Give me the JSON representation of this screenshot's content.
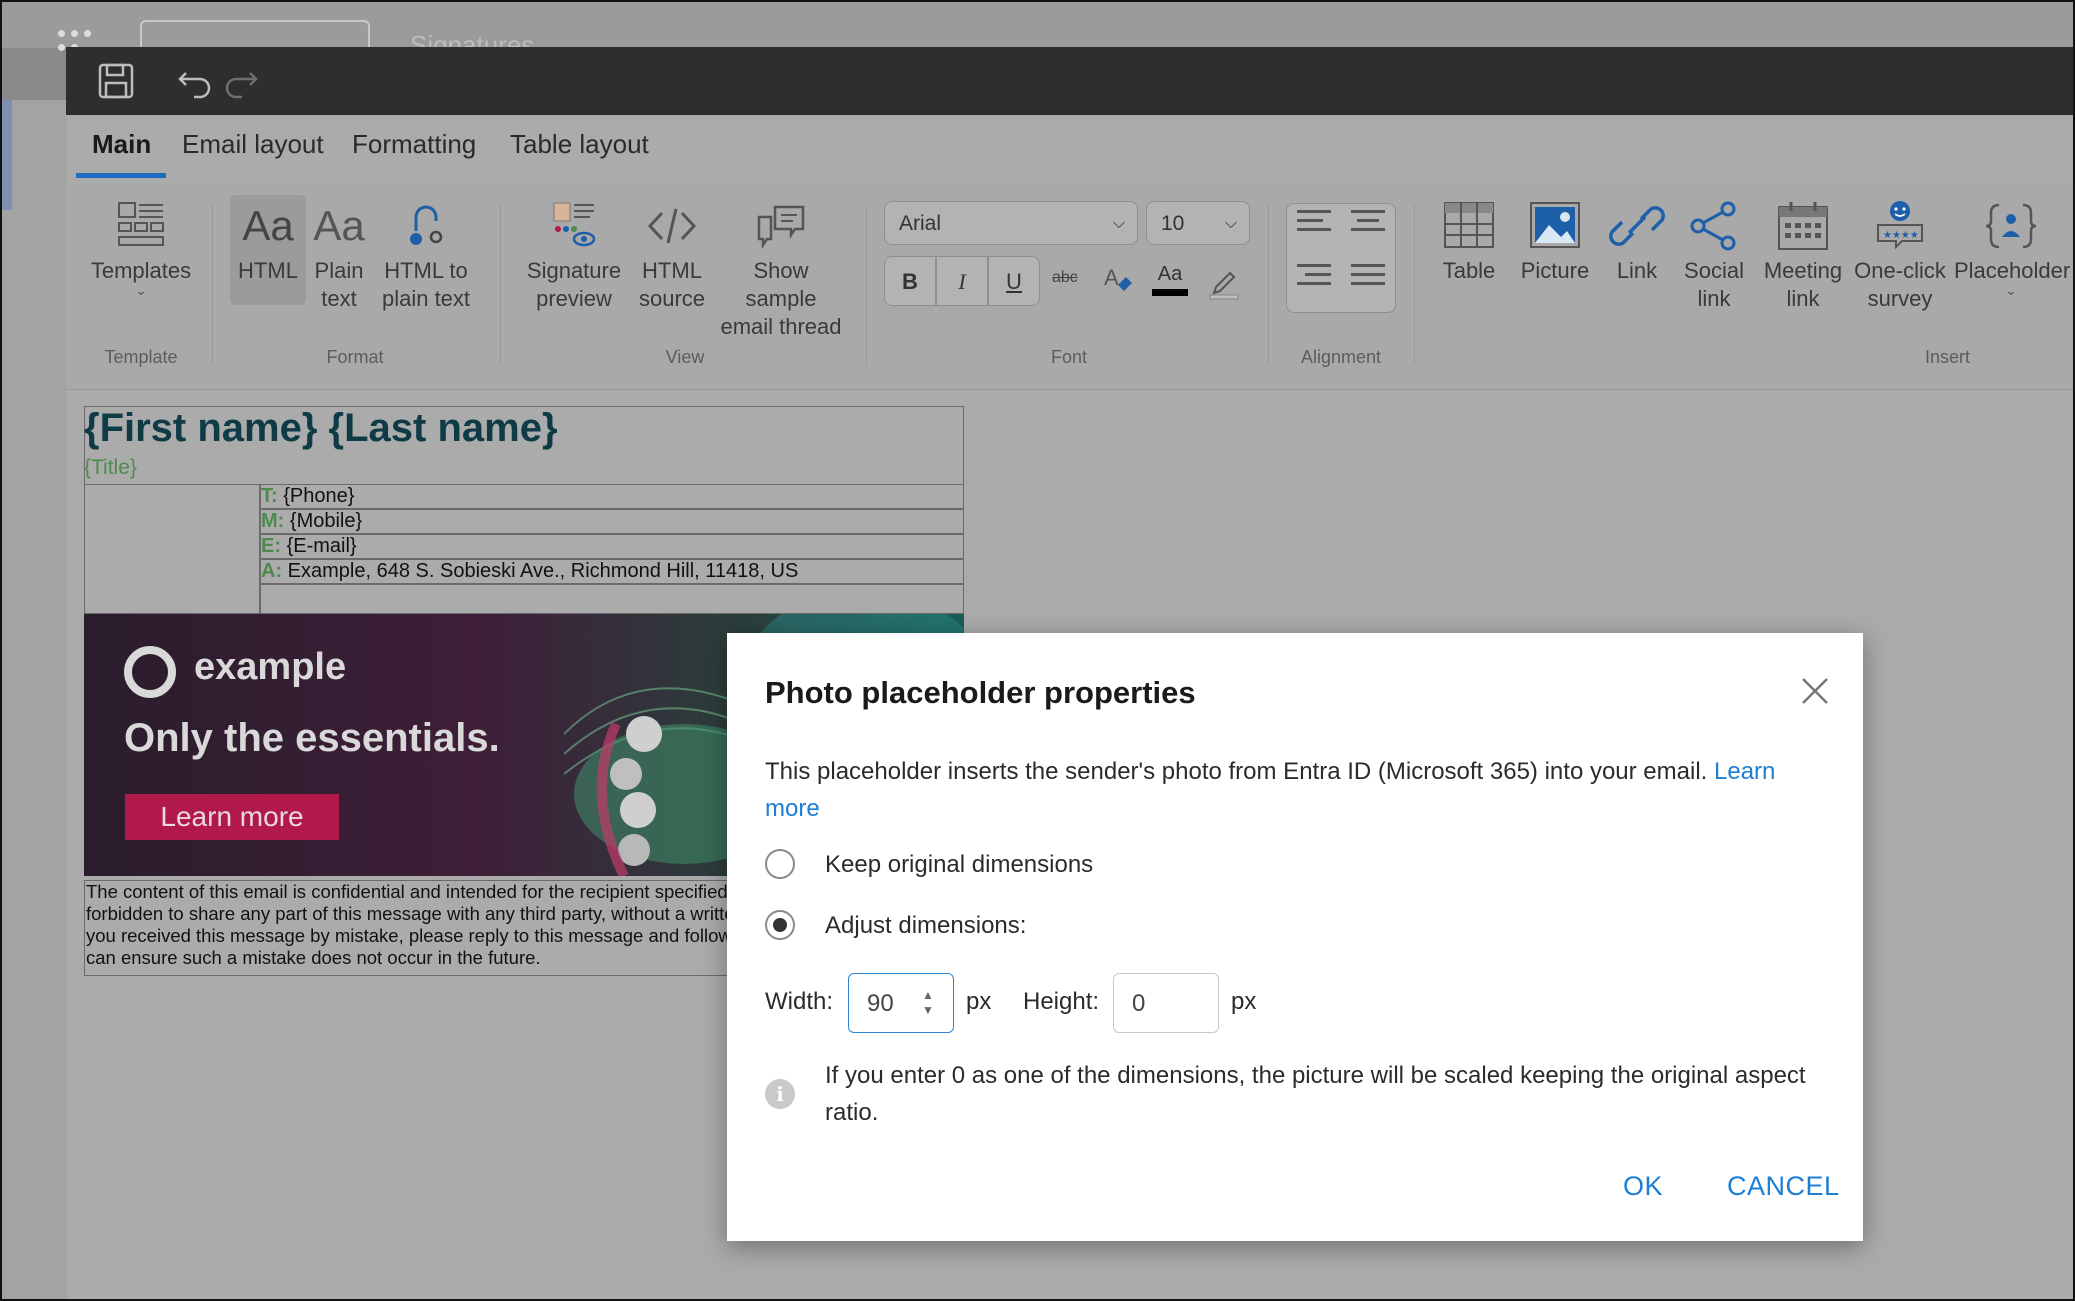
{
  "window": {
    "background_app_title": "Signatures"
  },
  "toolbar": {
    "save_icon": "save-icon",
    "undo_icon": "undo-icon",
    "redo_icon": "redo-icon"
  },
  "tabs": [
    {
      "label": "Main",
      "active": true
    },
    {
      "label": "Email layout",
      "active": false
    },
    {
      "label": "Formatting",
      "active": false
    },
    {
      "label": "Table layout",
      "active": false
    }
  ],
  "ribbon": {
    "template": {
      "templates_label": "Templates",
      "group_label": "Template"
    },
    "format": {
      "html_label": "HTML",
      "plain_text_label": "Plain text",
      "html_to_plain_label": "HTML to plain text",
      "group_label": "Format"
    },
    "view": {
      "signature_preview_label": "Signature preview",
      "html_source_label": "HTML source",
      "show_sample_label": "Show sample email thread",
      "group_label": "View"
    },
    "font": {
      "font_family": "Arial",
      "font_size": "10",
      "bold": "B",
      "italic": "I",
      "underline": "U",
      "strike": "abc",
      "font_color_sample": "Aa",
      "group_label": "Font"
    },
    "alignment": {
      "group_label": "Alignment"
    },
    "insert": {
      "table_label": "Table",
      "picture_label": "Picture",
      "link_label": "Link",
      "social_link_label": "Social link",
      "meeting_link_label": "Meeting link",
      "one_click_survey_label": "One-click survey",
      "placeholder_label": "Placeholder",
      "group_label": "Insert"
    }
  },
  "signature": {
    "name": "{First name} {Last name}",
    "title": "{Title}",
    "contacts": [
      {
        "key": "T:",
        "value": "{Phone}"
      },
      {
        "key": "M:",
        "value": "{Mobile}"
      },
      {
        "key": "E:",
        "value": "{E-mail}"
      },
      {
        "key": "A:",
        "value": "Example, 648 S. Sobieski Ave., Richmond Hill, 11418, US"
      }
    ],
    "banner": {
      "brand": "example",
      "tagline": "Only the essentials.",
      "button": "Learn more"
    },
    "disclaimer": "The content of this email is confidential and intended for the recipient specified in message only. It is strictly forbidden to share any part of this message with any third party, without a written consent of the sender. If you received this message by mistake, please reply to this message and follow with its deletion, so that we can ensure such a mistake does not occur in the future."
  },
  "dialog": {
    "title": "Photo placeholder properties",
    "description": "This placeholder inserts the sender's photo from Entra ID (Microsoft 365) into your email.",
    "learn_more": "Learn more",
    "options": [
      {
        "label": "Keep original dimensions",
        "checked": false
      },
      {
        "label": "Adjust dimensions:",
        "checked": true
      }
    ],
    "width_label": "Width:",
    "width_value": "90",
    "height_label": "Height:",
    "height_value": "0",
    "unit": "px",
    "info_text": "If you enter 0 as one of the dimensions, the picture will be scaled keeping the original aspect ratio.",
    "ok_label": "OK",
    "cancel_label": "CANCEL"
  },
  "colors": {
    "accent": "#1d7ed6",
    "tab_underline": "#1f6bbf",
    "name_color": "#0e3b45",
    "label_green": "#4e8a4e",
    "banner_button": "#b2194b"
  }
}
